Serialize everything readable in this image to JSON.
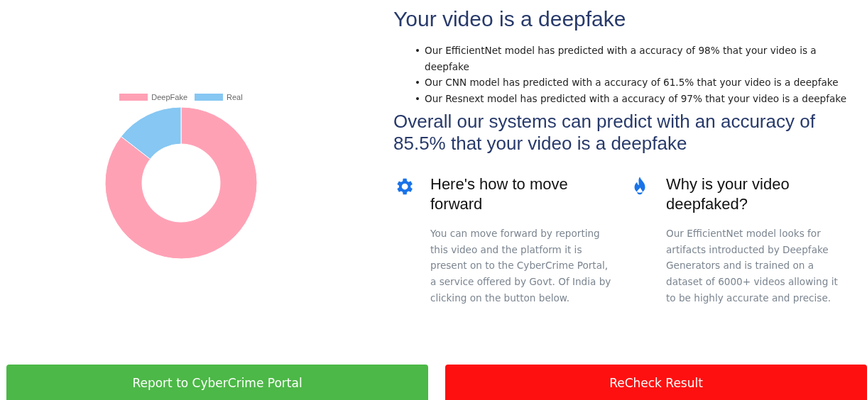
{
  "chart": {
    "chart_data": {
      "type": "donut",
      "categories": [
        "DeepFake",
        "Real"
      ],
      "values": [
        85.5,
        14.5
      ],
      "colors": [
        "#ffa1b5",
        "#86c7f3"
      ]
    }
  },
  "result": {
    "title": "Your video is a deepfake",
    "marker": "•",
    "models": [
      "Our EfficientNet model has predicted with a accuracy of 98% that your video is a deepfake",
      "Our CNN model has predicted with a accuracy of 61.5% that your video is a deepfake",
      "Our Resnext model has predicted with a accuracy of 97% that your video is a deepfake"
    ],
    "overall": "Overall our systems can predict with an accuracy of 85.5% that your video is a deepfake"
  },
  "features": [
    {
      "kind": "gear",
      "title": "Here's how to move forward",
      "text": "You can move forward by reporting this video and the platform it is present on to the CyberCrime Portal, a service offered by Govt. Of India by clicking on the button below."
    },
    {
      "kind": "flame",
      "title": "Why is your video deepfaked?",
      "text": "Our EfficientNet model looks for artifacts introducted by Deepfake Generators and is trained on a dataset of 6000+ videos allowing it to be highly accurate and precise."
    }
  ],
  "buttons": [
    {
      "label": "Report to CyberCrime Portal",
      "color": "#4cb847"
    },
    {
      "label": "ReCheck Result",
      "color": "#ff1010"
    }
  ]
}
